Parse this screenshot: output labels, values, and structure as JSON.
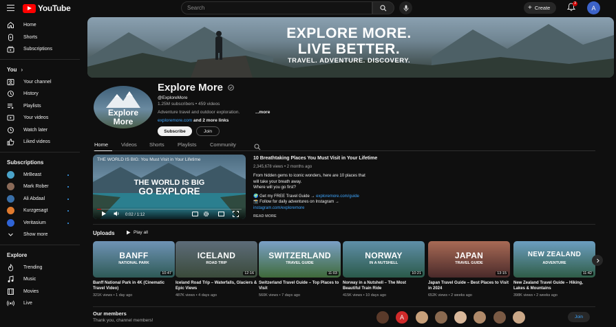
{
  "header": {
    "logo_text": "YouTube",
    "search_placeholder": "Search",
    "create_label": "Create",
    "notification_count": "3",
    "account_initial": "A"
  },
  "sidebar": {
    "main": [
      {
        "label": "Home",
        "icon": "home-icon"
      },
      {
        "label": "Shorts",
        "icon": "shorts-icon"
      },
      {
        "label": "Subscriptions",
        "icon": "subscriptions-icon"
      }
    ],
    "you_heading": "You",
    "you": [
      {
        "label": "Your channel",
        "icon": "channel-icon"
      },
      {
        "label": "History",
        "icon": "history-icon"
      },
      {
        "label": "Playlists",
        "icon": "playlists-icon"
      },
      {
        "label": "Your videos",
        "icon": "your-videos-icon"
      },
      {
        "label": "Watch later",
        "icon": "watch-later-icon"
      },
      {
        "label": "Liked videos",
        "icon": "liked-icon"
      }
    ],
    "subscriptions_heading": "Subscriptions",
    "subscriptions": [
      {
        "label": "MrBeast",
        "color": "#4aa3c9"
      },
      {
        "label": "Mark Rober",
        "color": "#8a6a58"
      },
      {
        "label": "Ali Abdaal",
        "color": "#3a6fa8"
      },
      {
        "label": "Kurzgesagt",
        "color": "#e07a2e"
      },
      {
        "label": "Veritasium",
        "color": "#2f64d6"
      }
    ],
    "show_more": "Show more",
    "explore_heading": "Explore",
    "explore": [
      {
        "label": "Trending",
        "icon": "trending-icon"
      },
      {
        "label": "Music",
        "icon": "music-icon"
      },
      {
        "label": "Movies",
        "icon": "movies-icon"
      },
      {
        "label": "Live",
        "icon": "live-icon"
      }
    ]
  },
  "banner": {
    "title_line1": "EXPLORE MORE.",
    "title_line2": "LIVE BETTER.",
    "tagline": "TRAVEL. ADVENTURE. DISCOVERY."
  },
  "channel": {
    "avatar_line1": "Explore",
    "avatar_line2": "More",
    "name": "Explore More",
    "handle": "@ExploreMore",
    "stats": "1.25M subscribers • 459 videos",
    "description": "Adventure travel and outdoor exploration.",
    "more_label": "...more",
    "link_text": "exploremore.com",
    "link_suffix": " and 2 more links",
    "subscribe_label": "Subscribe",
    "join_label": "Join"
  },
  "tabs": [
    "Home",
    "Videos",
    "Shorts",
    "Playlists",
    "Community"
  ],
  "featured": {
    "player_title": "THE WORLD IS BIG: You Must Visit in Your Lifetime",
    "overlay_line1": "THE WORLD IS BIG",
    "overlay_line2": "GO EXPLORE",
    "time": "0:02 / 1:12",
    "progress": 0.03,
    "title": "10 Breathtaking Places You Must Visit in Your Lifetime",
    "meta": "2,345,678 views • 2 months ago",
    "desc_line1": "From hidden gems to iconic wonders, here are 10 places that",
    "desc_line2": "will take your breath away.",
    "desc_line3": "Where will you go first?",
    "desc_line4_prefix": "🌍 Get my FREE Travel Guide → ",
    "desc_line4_link": "exploremore.com/guide",
    "desc_line5": "📸 Follow for daily adventures on Instagram →",
    "desc_line6_link": "instagram.com/exploremore",
    "read_more": "READ MORE"
  },
  "uploads": {
    "heading": "Uploads",
    "play_all": "Play all",
    "videos": [
      {
        "thumb_line1": "BANFF",
        "thumb_line2": "NATIONAL PARK",
        "duration": "10:47",
        "title": "Banff National Park in 4K (Cinematic Travel Video)",
        "meta": "321K views • 1 day ago",
        "c1": "#6f93b5",
        "c2": "#2e5a56"
      },
      {
        "thumb_line1": "ICELAND",
        "thumb_line2": "ROAD TRIP",
        "duration": "12:16",
        "title": "Iceland Road Trip – Waterfalls, Glaciers & Epic Views",
        "meta": "487K views • 4 days ago",
        "c1": "#5d6c79",
        "c2": "#3a4a3a"
      },
      {
        "thumb_line1": "SWITZERLAND",
        "thumb_line2": "TRAVEL GUIDE",
        "duration": "11:03",
        "title": "Switzerland Travel Guide – Top Places to Visit",
        "meta": "560K views • 7 days ago",
        "c1": "#7aa0c6",
        "c2": "#3f6a3a"
      },
      {
        "thumb_line1": "NORWAY",
        "thumb_line2": "IN A NUTSHELL",
        "duration": "10:21",
        "title": "Norway in a Nutshell – The Most Beautiful Train Ride",
        "meta": "415K views • 10 days ago",
        "c1": "#5f8fa8",
        "c2": "#2b5a4a"
      },
      {
        "thumb_line1": "JAPAN",
        "thumb_line2": "TRAVEL GUIDE",
        "duration": "13:15",
        "title": "Japan Travel Guide – Best Places to Visit in 2024",
        "meta": "652K views • 2 weeks ago",
        "c1": "#a86a55",
        "c2": "#4a2a2a"
      },
      {
        "thumb_line1": "NEW ZEALAND",
        "thumb_line2": "ADVENTURE",
        "duration": "11:42",
        "title": "New Zealand Travel Guide – Hiking, Lakes & Mountains",
        "meta": "398K views • 2 weeks ago",
        "c1": "#6c9ec0",
        "c2": "#2f5d47"
      }
    ]
  },
  "members": {
    "heading": "Our members",
    "subtitle": "Thank you, channel members!",
    "join_label": "Join",
    "letter_avatar": "A",
    "avatar_colors": [
      "#5a3a2a",
      "#d02a2a",
      "#c8a07a",
      "#8a6a50",
      "#d9b89a",
      "#b08a6a",
      "#7a5a44",
      "#caa888"
    ]
  }
}
